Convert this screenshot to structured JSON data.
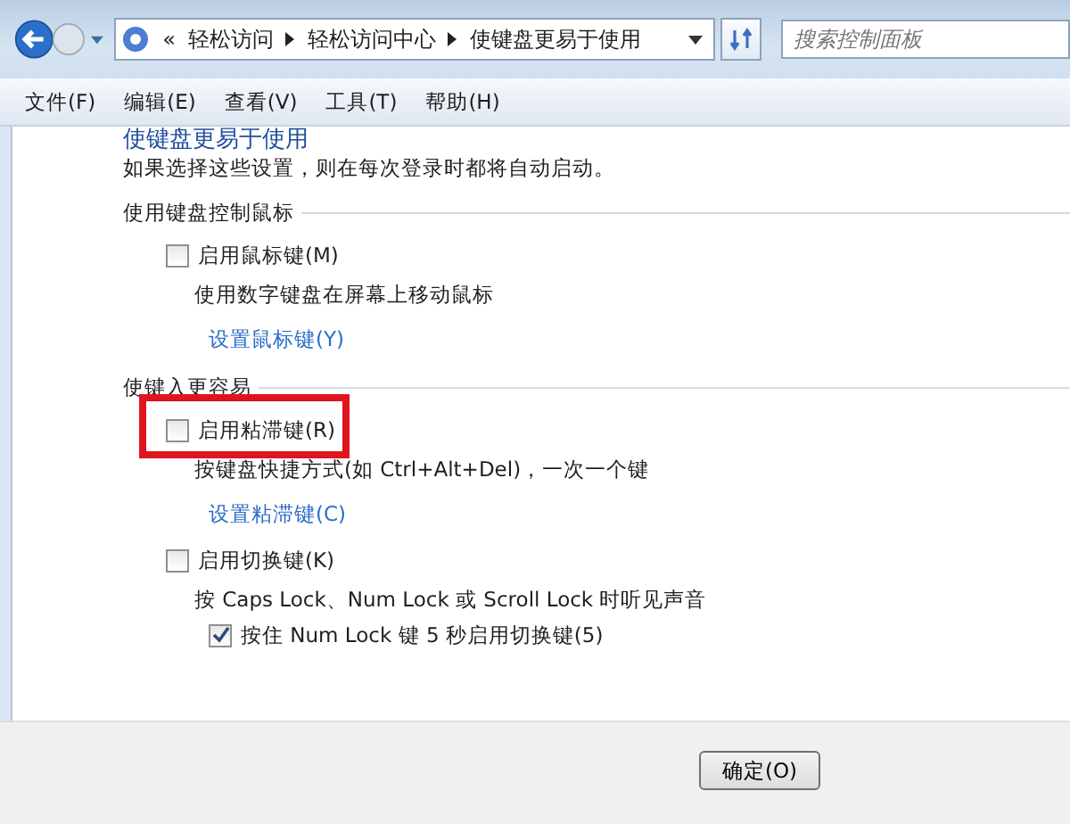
{
  "breadcrumb": {
    "overflow": "«",
    "items": [
      "轻松访问",
      "轻松访问中心",
      "使键盘更易于使用"
    ]
  },
  "search": {
    "placeholder": "搜索控制面板"
  },
  "menu": [
    "文件(F)",
    "编辑(E)",
    "查看(V)",
    "工具(T)",
    "帮助(H)"
  ],
  "page": {
    "title": "使键盘更易于使用",
    "intro": "如果选择这些设置，则在每次登录时都将自动启动。",
    "sections": [
      {
        "title": "使用键盘控制鼠标",
        "items": [
          {
            "kind": "checkbox",
            "label": "启用鼠标键(M)",
            "checked": false,
            "highlighted": false
          },
          {
            "kind": "text",
            "text": "使用数字键盘在屏幕上移动鼠标"
          },
          {
            "kind": "link",
            "text": "设置鼠标键(Y)"
          }
        ]
      },
      {
        "title": "使键入更容易",
        "items": [
          {
            "kind": "checkbox",
            "label": "启用粘滞键(R)",
            "checked": false,
            "highlighted": true
          },
          {
            "kind": "text",
            "text": "按键盘快捷方式(如 Ctrl+Alt+Del)，一次一个键"
          },
          {
            "kind": "link",
            "text": "设置粘滞键(C)"
          },
          {
            "kind": "checkbox",
            "label": "启用切换键(K)",
            "checked": false,
            "highlighted": false
          },
          {
            "kind": "text",
            "text": "按 Caps Lock、Num Lock 或 Scroll Lock 时听见声音"
          },
          {
            "kind": "subcheckbox",
            "label": "按住 Num Lock 键 5 秒启用切换键(5)",
            "checked": true,
            "highlighted": false
          }
        ]
      }
    ]
  },
  "buttons": [
    "确定(O)"
  ]
}
